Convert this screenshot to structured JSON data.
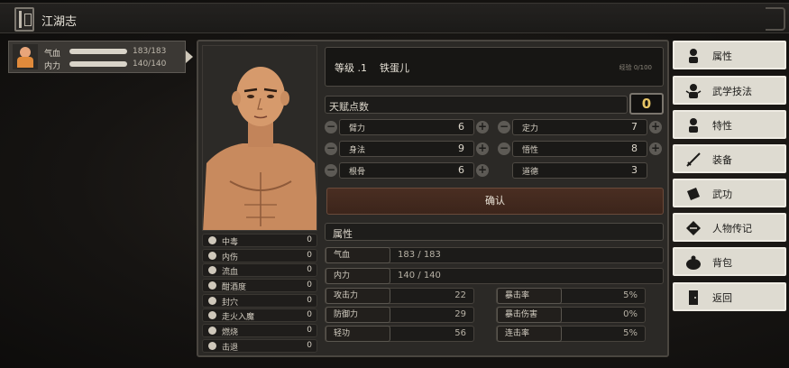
{
  "topbar": {
    "title": "江湖志"
  },
  "character_card": {
    "rows": [
      {
        "label": "气血",
        "value": "183/183",
        "fill": 1.0
      },
      {
        "label": "内力",
        "value": "140/140",
        "fill": 1.0
      }
    ]
  },
  "status_effects": [
    {
      "label": "中毒",
      "value": "0"
    },
    {
      "label": "内伤",
      "value": "0"
    },
    {
      "label": "流血",
      "value": "0"
    },
    {
      "label": "酣酒度",
      "value": "0"
    },
    {
      "label": "封穴",
      "value": "0"
    },
    {
      "label": "走火入魔",
      "value": "0"
    },
    {
      "label": "燃烧",
      "value": "0"
    },
    {
      "label": "击退",
      "value": "0"
    }
  ],
  "level": {
    "label": "等级 .1",
    "name": "铁蛋儿",
    "exp": "经验 0/100"
  },
  "talent": {
    "label": "天赋点数",
    "points": "0"
  },
  "attributes": [
    {
      "label": "臂力",
      "value": "6"
    },
    {
      "label": "定力",
      "value": "7"
    },
    {
      "label": "身法",
      "value": "9"
    },
    {
      "label": "悟性",
      "value": "8"
    },
    {
      "label": "根骨",
      "value": "6"
    },
    {
      "label": "道德",
      "value": "3"
    }
  ],
  "confirm_label": "确认",
  "section_title": "属性",
  "wide_stats": [
    {
      "label": "气血",
      "value": "183 / 183"
    },
    {
      "label": "内力",
      "value": "140 / 140"
    }
  ],
  "combat_stats_left": [
    {
      "label": "攻击力",
      "value": "22"
    },
    {
      "label": "防御力",
      "value": "29"
    },
    {
      "label": "轻功",
      "value": "56"
    }
  ],
  "combat_stats_right": [
    {
      "label": "暴击率",
      "value": "5%"
    },
    {
      "label": "暴击伤害",
      "value": "0%"
    },
    {
      "label": "连击率",
      "value": "5%"
    }
  ],
  "menu": [
    {
      "label": "属性",
      "icon": "person-icon"
    },
    {
      "label": "武学技法",
      "icon": "martial-arts-icon"
    },
    {
      "label": "特性",
      "icon": "trait-icon"
    },
    {
      "label": "装备",
      "icon": "sword-icon"
    },
    {
      "label": "武功",
      "icon": "book-icon"
    },
    {
      "label": "人物传记",
      "icon": "scroll-icon"
    },
    {
      "label": "背包",
      "icon": "bag-icon"
    },
    {
      "label": "返回",
      "icon": "door-icon"
    }
  ]
}
